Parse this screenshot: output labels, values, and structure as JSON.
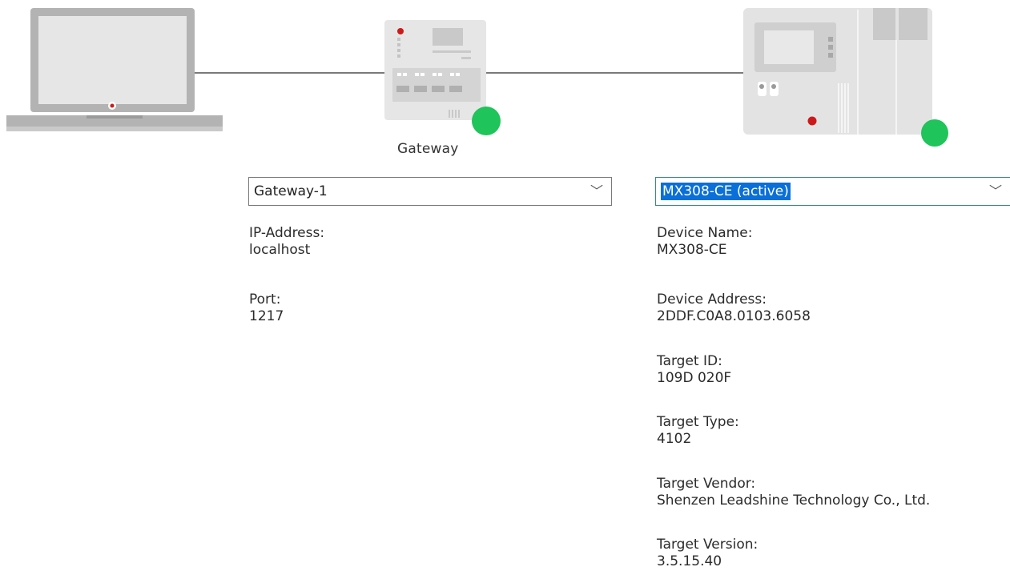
{
  "diagram": {
    "gateway_label": "Gateway"
  },
  "gateway": {
    "selected": "Gateway-1",
    "fields": [
      {
        "label": "IP-Address:",
        "value": "localhost"
      },
      {
        "label": "Port:",
        "value": "1217"
      }
    ]
  },
  "device": {
    "selected": "MX308-CE (active)",
    "fields": [
      {
        "label": "Device Name:",
        "value": "MX308-CE"
      },
      {
        "label": "Device Address:",
        "value": "2DDF.C0A8.0103.6058"
      },
      {
        "label": "Target ID:",
        "value": "109D 020F"
      },
      {
        "label": "Target Type:",
        "value": "4102"
      },
      {
        "label": "Target Vendor:",
        "value": "Shenzen Leadshine Technology Co., Ltd."
      },
      {
        "label": "Target Version:",
        "value": "3.5.15.40"
      }
    ]
  },
  "colors": {
    "status_online": "#1fc45a",
    "accent_red": "#cc1a1a",
    "device_gray": "#e3e3e3",
    "selection_blue": "#0a6fd8"
  },
  "icons": [
    "laptop-icon",
    "gateway-device-icon",
    "plc-controller-icon",
    "status-online-icon",
    "chevron-down-icon"
  ]
}
